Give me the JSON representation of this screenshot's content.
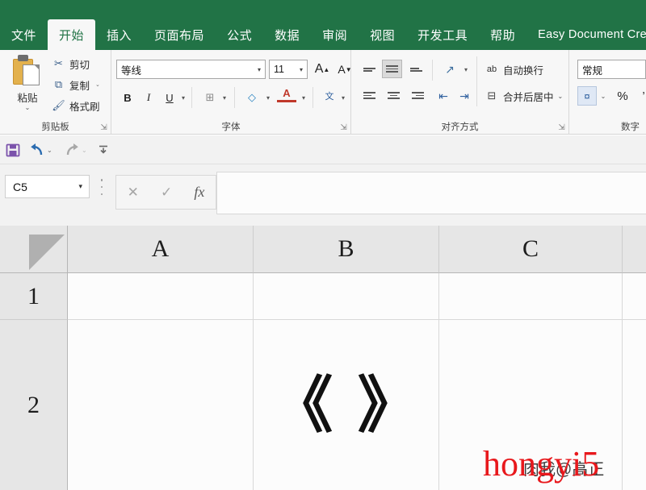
{
  "app": {
    "brand_green": "#217346",
    "ribbon_bg": "#f7f7f7"
  },
  "tabs": [
    {
      "label": "文件",
      "active": false
    },
    {
      "label": "开始",
      "active": true
    },
    {
      "label": "插入",
      "active": false
    },
    {
      "label": "页面布局",
      "active": false
    },
    {
      "label": "公式",
      "active": false
    },
    {
      "label": "数据",
      "active": false
    },
    {
      "label": "审阅",
      "active": false
    },
    {
      "label": "视图",
      "active": false
    },
    {
      "label": "开发工具",
      "active": false
    },
    {
      "label": "帮助",
      "active": false
    },
    {
      "label": "Easy Document Creator",
      "active": false
    }
  ],
  "ribbon": {
    "clipboard": {
      "group_label": "剪贴板",
      "paste_label": "粘贴",
      "paste_caret": "⌄",
      "cut_label": "剪切",
      "cut_icon": "✂",
      "copy_label": "复制",
      "copy_icon": "⧉",
      "copy_caret": "⌄",
      "format_painter_label": "格式刷",
      "format_painter_icon": "🖌",
      "launcher_icon": "⇲"
    },
    "font": {
      "group_label": "字体",
      "font_name": "等线",
      "font_size": "11",
      "caret": "▾",
      "grow_font": "A",
      "shrink_font": "A",
      "bold": "B",
      "italic": "I",
      "underline": "U",
      "borders_icon": "⊞",
      "fill_icon": "◇",
      "font_color_icon": "A",
      "phonetic_icon": "文",
      "launcher_icon": "⇲"
    },
    "alignment": {
      "group_label": "对齐方式",
      "align_top": "top-align",
      "align_middle": "middle-align",
      "align_bottom": "bottom-align",
      "align_left": "left-align",
      "align_center": "center-align",
      "align_right": "right-align",
      "orientation_icon": "↗",
      "decrease_indent_icon": "⇤",
      "increase_indent_icon": "⇥",
      "wrap_text_label": "自动换行",
      "wrap_text_icon": "ab",
      "merge_center_label": "合并后居中",
      "merge_center_icon": "⊟",
      "merge_caret": "⌄",
      "launcher_icon": "⇲"
    },
    "number": {
      "group_label": "数字",
      "format_value": "常规",
      "accounting_icon": "¤",
      "accounting_caret": "⌄",
      "percent_icon": "%",
      "comma_icon": "’"
    }
  },
  "quick_access": {
    "save_icon": "save-icon",
    "undo_icon": "↶",
    "undo_caret": "⌄",
    "redo_icon": "↷",
    "redo_caret": "⌄",
    "customize_icon": "⤓"
  },
  "formula_bar": {
    "name_box_value": "C5",
    "name_box_caret": "▾",
    "cancel_icon": "✕",
    "confirm_icon": "✓",
    "function_icon": "fx",
    "formula_value": "",
    "formula_placeholder": ""
  },
  "grid": {
    "select_all": "select-all",
    "columns": [
      "A",
      "B",
      "C"
    ],
    "rows": [
      "1",
      "2"
    ],
    "cells": [
      {
        "row": "1",
        "col": "A",
        "value": ""
      },
      {
        "row": "1",
        "col": "B",
        "value": ""
      },
      {
        "row": "1",
        "col": "C",
        "value": ""
      },
      {
        "row": "2",
        "col": "A",
        "value": ""
      },
      {
        "row": "2",
        "col": "B",
        "value": "《 》"
      },
      {
        "row": "2",
        "col": "C",
        "value": ""
      }
    ]
  },
  "watermarks": {
    "dark_text": "肉我@高正",
    "red_text": "hongyi5",
    "red_color": "#e8181c"
  }
}
